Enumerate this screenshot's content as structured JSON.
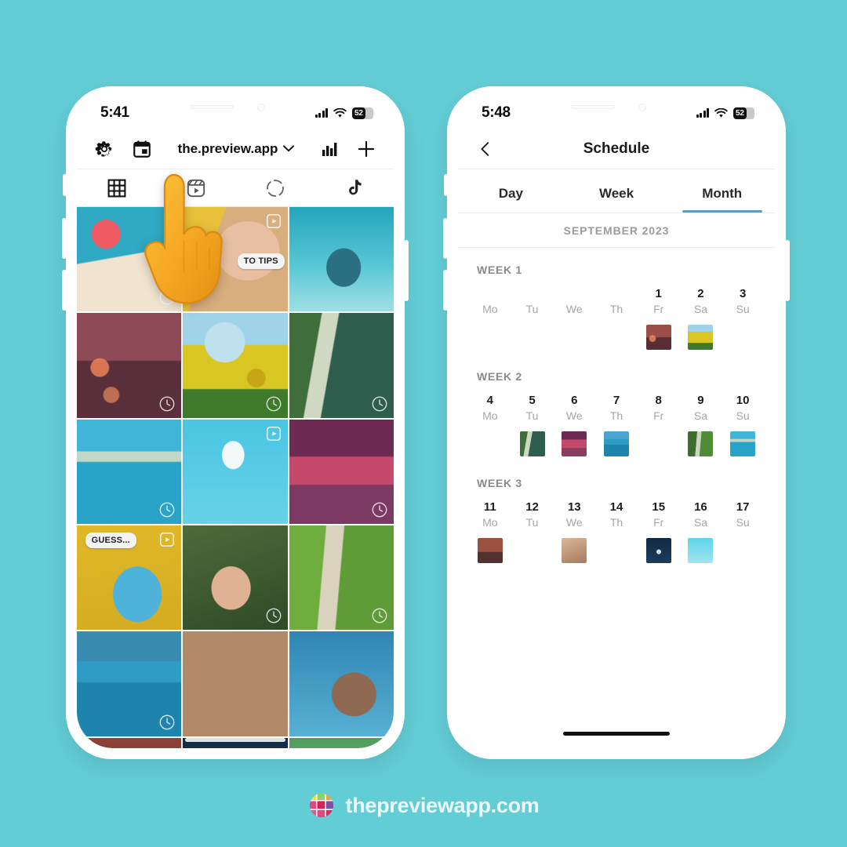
{
  "page": {
    "background_color": "#63cdd6",
    "brand": {
      "text": "thepreviewapp.com",
      "logo_icon": "preview-grid-logo-icon"
    }
  },
  "left_phone": {
    "status_bar": {
      "time": "5:41",
      "signal_icon": "cell-signal-icon",
      "wifi_icon": "wifi-icon",
      "battery_icon": "battery-icon",
      "battery_level": "52"
    },
    "header": {
      "settings_icon": "gear-icon",
      "calendar_icon": "calendar-icon",
      "username": "the.preview.app",
      "chevron_icon": "chevron-down-icon",
      "analytics_icon": "bar-chart-icon",
      "add_icon": "plus-icon"
    },
    "tabs": [
      {
        "name": "grid",
        "icon": "grid-icon",
        "active": true
      },
      {
        "name": "reels",
        "icon": "reels-icon",
        "active": false
      },
      {
        "name": "stories",
        "icon": "stories-circle-icon",
        "active": false
      },
      {
        "name": "tiktok",
        "icon": "tiktok-icon",
        "active": false
      }
    ],
    "pointer_emoji": "pointing-up-hand-emoji",
    "grid": {
      "columns": 3,
      "cells": [
        {
          "id": "r1c1",
          "alt": "girl-on-pink-float-in-pool",
          "badge": "clock-icon",
          "label": ""
        },
        {
          "id": "r1c2",
          "alt": "woman-yellow-wall-video",
          "badge": "reel-icon",
          "label": "TO TIPS"
        },
        {
          "id": "r1c3",
          "alt": "snorkeler-in-turquoise-water",
          "badge": "",
          "label": ""
        },
        {
          "id": "r2c1",
          "alt": "silhouette-sunset-bokeh-drink",
          "badge": "clock-icon",
          "label": ""
        },
        {
          "id": "r2c2",
          "alt": "woman-in-sunflower-field",
          "badge": "clock-icon",
          "label": ""
        },
        {
          "id": "r2c3",
          "alt": "woman-at-jungle-waterfall",
          "badge": "clock-icon",
          "label": ""
        },
        {
          "id": "r3c1",
          "alt": "woman-in-cliff-pool-half-underwater",
          "badge": "clock-icon",
          "label": ""
        },
        {
          "id": "r3c2",
          "alt": "aerial-boat-and-stingrays",
          "badge": "reel-icon",
          "label": ""
        },
        {
          "id": "r3c3",
          "alt": "woman-silhouette-purple-sunset",
          "badge": "clock-icon",
          "label": ""
        },
        {
          "id": "r4c1",
          "alt": "woman-on-pool-float-yellow",
          "badge": "reel-icon",
          "label": "GUESS..."
        },
        {
          "id": "r4c2",
          "alt": "smiling-woman-in-plants",
          "badge": "clock-icon",
          "label": ""
        },
        {
          "id": "r4c3",
          "alt": "aerial-path-through-palms",
          "badge": "clock-icon",
          "label": ""
        },
        {
          "id": "r5c1",
          "alt": "hand-over-harbour-boats",
          "badge": "clock-icon",
          "label": ""
        },
        {
          "id": "r5c2",
          "alt": "portrait-shadow-stripes-face",
          "badge": "",
          "label": ""
        },
        {
          "id": "r5c3",
          "alt": "woman-against-blue-sky",
          "badge": "",
          "label": ""
        },
        {
          "id": "r6c1",
          "alt": "palm-trees-sunset-silhouette",
          "badge": "",
          "label": ""
        },
        {
          "id": "r6c2",
          "alt": "dark-blue-ocean-surface",
          "badge": "",
          "label": ""
        },
        {
          "id": "r6c3",
          "alt": "brown-puppy-on-grass",
          "badge": "",
          "label": ""
        }
      ]
    }
  },
  "right_phone": {
    "status_bar": {
      "time": "5:48",
      "signal_icon": "cell-signal-icon",
      "wifi_icon": "wifi-icon",
      "battery_icon": "battery-icon",
      "battery_level": "52"
    },
    "header": {
      "back_icon": "chevron-left-icon",
      "title": "Schedule"
    },
    "view_tabs": [
      {
        "label": "Day",
        "active": false
      },
      {
        "label": "Week",
        "active": false
      },
      {
        "label": "Month",
        "active": true
      }
    ],
    "active_tab_color": "#5b9dc4",
    "month_label": "SEPTEMBER 2023",
    "weeks": [
      {
        "label": "WEEK 1",
        "days": [
          {
            "num": "",
            "dow": "Mo",
            "thumb": null
          },
          {
            "num": "",
            "dow": "Tu",
            "thumb": null
          },
          {
            "num": "",
            "dow": "We",
            "thumb": null
          },
          {
            "num": "",
            "dow": "Th",
            "thumb": null
          },
          {
            "num": "1",
            "dow": "Fr",
            "thumb": "silhouette-sunset-bokeh-drink"
          },
          {
            "num": "2",
            "dow": "Sa",
            "thumb": "woman-in-sunflower-field"
          },
          {
            "num": "3",
            "dow": "Su",
            "thumb": null
          }
        ]
      },
      {
        "label": "WEEK 2",
        "days": [
          {
            "num": "4",
            "dow": "Mo",
            "thumb": null
          },
          {
            "num": "5",
            "dow": "Tu",
            "thumb": "woman-at-jungle-waterfall"
          },
          {
            "num": "6",
            "dow": "We",
            "thumb": "woman-silhouette-purple-sunset"
          },
          {
            "num": "7",
            "dow": "Th",
            "thumb": "hand-over-harbour-boats"
          },
          {
            "num": "8",
            "dow": "Fr",
            "thumb": null
          },
          {
            "num": "9",
            "dow": "Sa",
            "thumb": "aerial-path-through-palms"
          },
          {
            "num": "10",
            "dow": "Su",
            "thumb": "woman-in-cliff-pool-half-underwater"
          }
        ]
      },
      {
        "label": "WEEK 3",
        "days": [
          {
            "num": "11",
            "dow": "Mo",
            "thumb": "palm-trees-sunset-silhouette"
          },
          {
            "num": "12",
            "dow": "Tu",
            "thumb": null
          },
          {
            "num": "13",
            "dow": "We",
            "thumb": "portrait-shadow-stripes-face"
          },
          {
            "num": "14",
            "dow": "Th",
            "thumb": null
          },
          {
            "num": "15",
            "dow": "Fr",
            "thumb": "dark-blue-ocean-surface"
          },
          {
            "num": "16",
            "dow": "Sa",
            "thumb": "aerial-boat-and-stingrays"
          },
          {
            "num": "17",
            "dow": "Su",
            "thumb": null
          }
        ]
      }
    ]
  }
}
